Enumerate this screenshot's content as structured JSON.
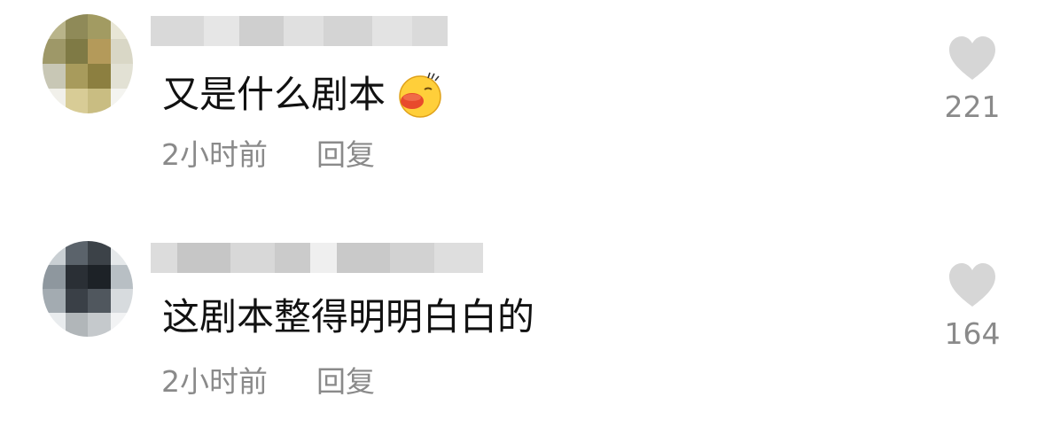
{
  "comments": [
    {
      "text": "又是什么剧本",
      "time": "2小时前",
      "reply_label": "回复",
      "likes": "221",
      "emoji_icon": "kissing-face-emoji"
    },
    {
      "text": "这剧本整得明明白白的",
      "time": "2小时前",
      "reply_label": "回复",
      "likes": "164"
    }
  ],
  "colors": {
    "text": "#111111",
    "meta": "#8a8a8a",
    "heart": "#d6d6d6"
  }
}
